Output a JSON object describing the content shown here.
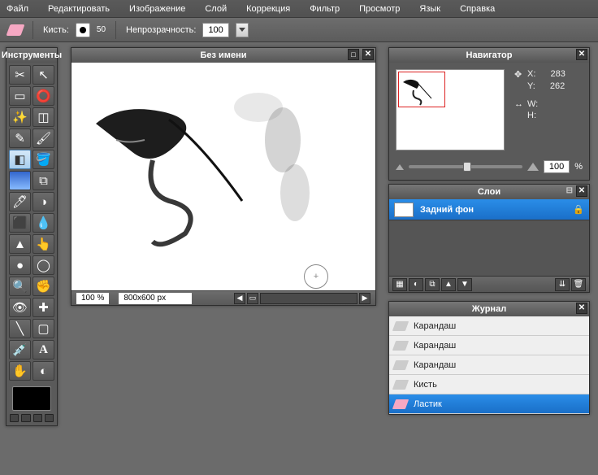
{
  "menu": {
    "file": "Файл",
    "edit": "Редактировать",
    "image": "Изображение",
    "layer": "Слой",
    "adjust": "Коррекция",
    "filter": "Фильтр",
    "view": "Просмотр",
    "lang": "Язык",
    "help": "Справка"
  },
  "options": {
    "brush_label": "Кисть:",
    "brush_size": "50",
    "opacity_label": "Непрозрачность:",
    "opacity_value": "100"
  },
  "toolbox": {
    "title": "Инструменты"
  },
  "canvas": {
    "title": "Без имени",
    "zoom": "100 %",
    "dims": "800x600 px",
    "cursor": "+"
  },
  "navigator": {
    "title": "Навигатор",
    "x_label": "X:",
    "x": "283",
    "y_label": "Y:",
    "y": "262",
    "w_label": "W:",
    "w": "",
    "h_label": "H:",
    "h": "",
    "zoom": "100",
    "pct": "%"
  },
  "layers": {
    "title": "Слои",
    "items": [
      {
        "name": "Задний фон"
      }
    ]
  },
  "history": {
    "title": "Журнал",
    "items": [
      {
        "name": "Карандаш",
        "sel": false
      },
      {
        "name": "Карандаш",
        "sel": false
      },
      {
        "name": "Карандаш",
        "sel": false
      },
      {
        "name": "Кисть",
        "sel": false
      },
      {
        "name": "Ластик",
        "sel": true
      }
    ]
  }
}
